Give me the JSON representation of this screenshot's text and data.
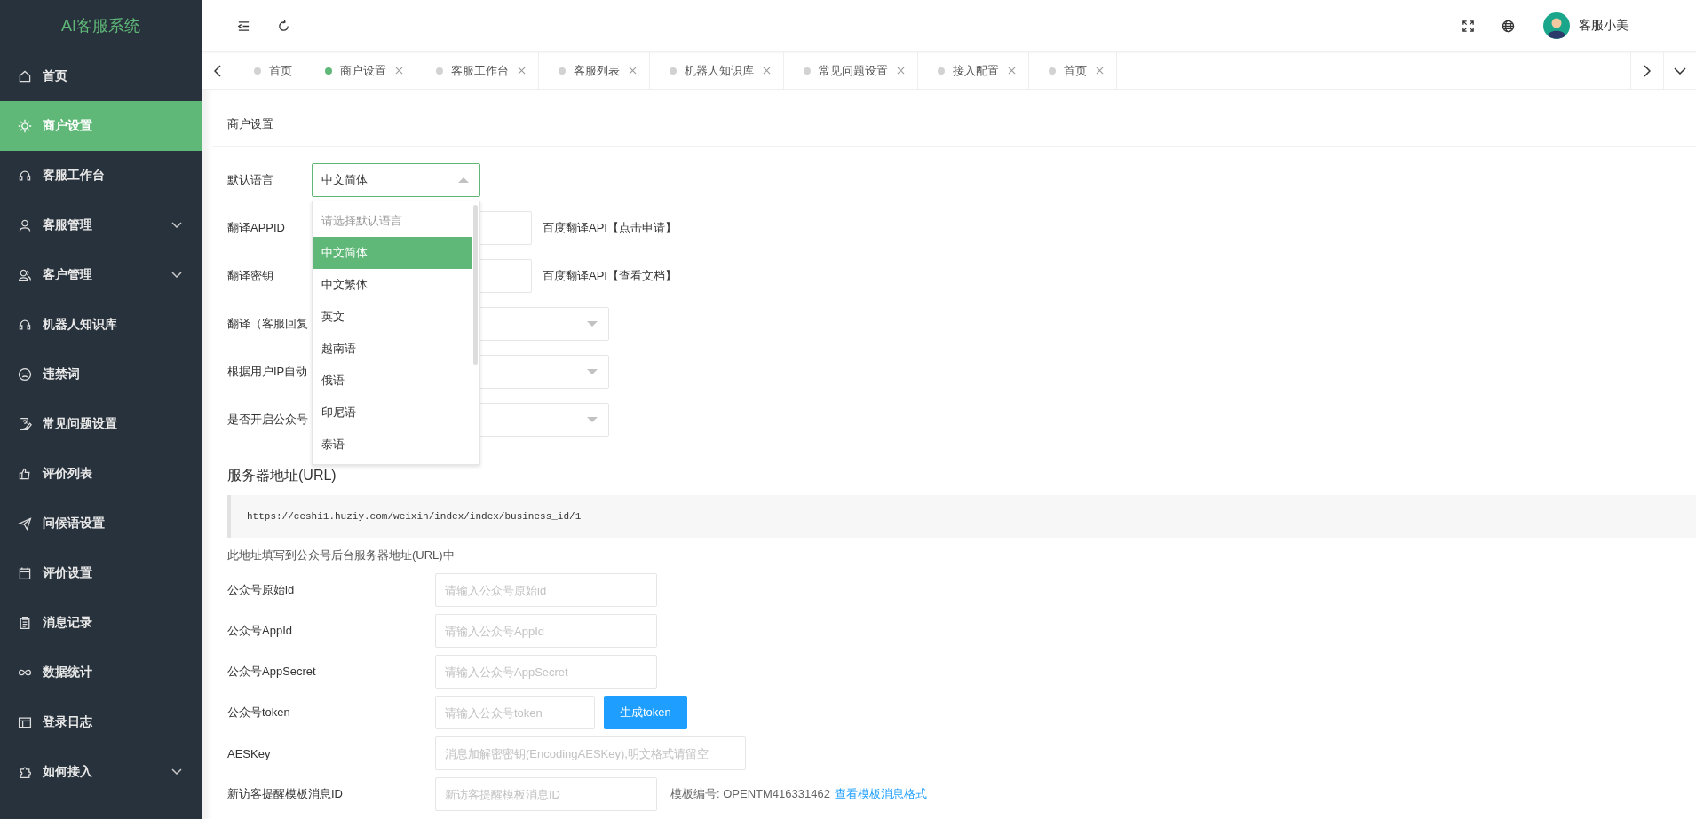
{
  "sidebar": {
    "logo": "AI客服系统",
    "items": [
      {
        "label": "首页",
        "selected": false,
        "expandable": false
      },
      {
        "label": "商户设置",
        "selected": true,
        "expandable": false
      },
      {
        "label": "客服工作台",
        "selected": false,
        "expandable": false
      },
      {
        "label": "客服管理",
        "selected": false,
        "expandable": true
      },
      {
        "label": "客户管理",
        "selected": false,
        "expandable": true
      },
      {
        "label": "机器人知识库",
        "selected": false,
        "expandable": false
      },
      {
        "label": "违禁词",
        "selected": false,
        "expandable": false
      },
      {
        "label": "常见问题设置",
        "selected": false,
        "expandable": false
      },
      {
        "label": "评价列表",
        "selected": false,
        "expandable": false
      },
      {
        "label": "问候语设置",
        "selected": false,
        "expandable": false
      },
      {
        "label": "评价设置",
        "selected": false,
        "expandable": false
      },
      {
        "label": "消息记录",
        "selected": false,
        "expandable": false
      },
      {
        "label": "数据统计",
        "selected": false,
        "expandable": false
      },
      {
        "label": "登录日志",
        "selected": false,
        "expandable": false
      },
      {
        "label": "如何接入",
        "selected": false,
        "expandable": true
      }
    ]
  },
  "header": {
    "user_name": "客服小美"
  },
  "tabs": [
    {
      "label": "首页",
      "selected": false,
      "closable": false
    },
    {
      "label": "商户设置",
      "selected": true,
      "closable": true
    },
    {
      "label": "客服工作台",
      "selected": false,
      "closable": true
    },
    {
      "label": "客服列表",
      "selected": false,
      "closable": true
    },
    {
      "label": "机器人知识库",
      "selected": false,
      "closable": true
    },
    {
      "label": "常见问题设置",
      "selected": false,
      "closable": true
    },
    {
      "label": "接入配置",
      "selected": false,
      "closable": true
    },
    {
      "label": "首页",
      "selected": false,
      "closable": true
    }
  ],
  "page_title": "商户设置",
  "language_select": {
    "label": "默认语言",
    "value": "中文简体",
    "expanded": true,
    "options": [
      {
        "label": "请选择默认语言",
        "kind": "placeholder",
        "selected": false
      },
      {
        "label": "中文简体",
        "kind": "option",
        "selected": true
      },
      {
        "label": "中文繁体",
        "kind": "option",
        "selected": false
      },
      {
        "label": "英文",
        "kind": "option",
        "selected": false
      },
      {
        "label": "越南语",
        "kind": "option",
        "selected": false
      },
      {
        "label": "俄语",
        "kind": "option",
        "selected": false
      },
      {
        "label": "印尼语",
        "kind": "option",
        "selected": false
      },
      {
        "label": "泰语",
        "kind": "option",
        "selected": false
      }
    ]
  },
  "translate_fields": [
    {
      "label": "翻译APPID",
      "link": "百度翻译API【点击申请】"
    },
    {
      "label": "翻译密钥",
      "link": "百度翻译API【查看文档】"
    }
  ],
  "select_fields": [
    {
      "label": "翻译（客服回复"
    },
    {
      "label": "根据用户IP自动"
    },
    {
      "label": "是否开启公众号"
    }
  ],
  "server_url": {
    "heading": "服务器地址(URL)",
    "url": "https://ceshi1.huziy.com/weixin/index/index/business_id/1",
    "note": "此地址填写到公众号后台服务器地址(URL)中"
  },
  "wechat_fields": [
    {
      "label": "公众号原始id",
      "placeholder": "请输入公众号原始id",
      "kind": "normal"
    },
    {
      "label": "公众号AppId",
      "placeholder": "请输入公众号AppId",
      "kind": "normal"
    },
    {
      "label": "公众号AppSecret",
      "placeholder": "请输入公众号AppSecret",
      "kind": "normal"
    },
    {
      "label": "公众号token",
      "placeholder": "请输入公众号token",
      "kind": "button",
      "button": "生成token"
    },
    {
      "label": "AESKey",
      "placeholder": "消息加解密密钥(EncodingAESKey),明文格式请留空",
      "kind": "wide"
    },
    {
      "label": "新访客提醒模板消息ID",
      "placeholder": "新访客提醒模板消息ID",
      "kind": "hint",
      "hint": "模板编号: OPENTM416331462",
      "link": "查看模板消息格式"
    }
  ]
}
